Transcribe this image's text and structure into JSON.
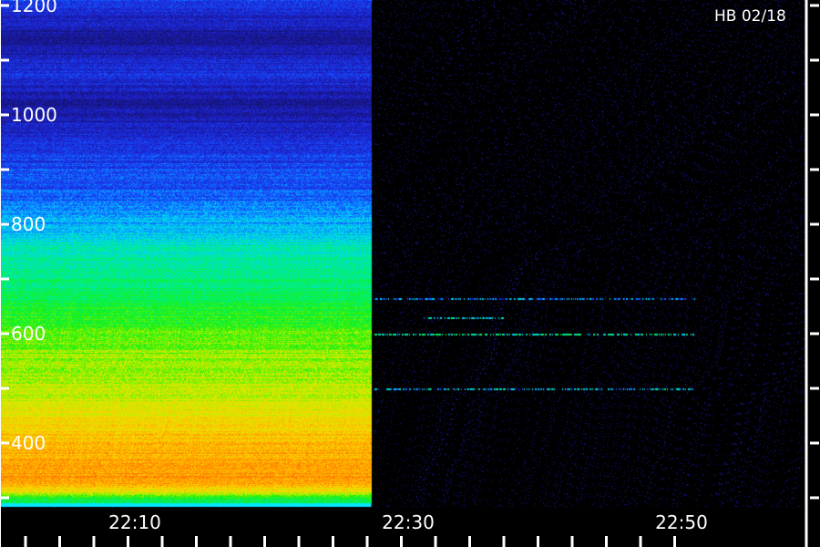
{
  "chart_data": {
    "type": "heatmap",
    "title": "",
    "xlabel": "",
    "ylabel": "",
    "station_label": "HB 02/18",
    "x_unit": "minutes",
    "x_ticks": [
      {
        "value": 10,
        "label": "22:10"
      },
      {
        "value": 30,
        "label": "22:30"
      },
      {
        "value": 50,
        "label": "22:50"
      }
    ],
    "xlim": [
      2,
      51
    ],
    "x_minor_step": 2.5,
    "y_ticks": [
      {
        "value": 400,
        "label": "400"
      },
      {
        "value": 600,
        "label": "600"
      },
      {
        "value": 800,
        "label": "800"
      },
      {
        "value": 1000,
        "label": "1000"
      },
      {
        "value": 1200,
        "label": "1200"
      }
    ],
    "ylim": [
      290,
      1200
    ],
    "y_minor_step": 100,
    "signal_end_time": 27.3,
    "burst_start_time": 28.2,
    "colormap": [
      "#14146e",
      "#1e1ec8",
      "#1450ff",
      "#00d2ff",
      "#00f08c",
      "#14f00a",
      "#c8f000",
      "#ffd200",
      "#ff8200",
      "#ff3c00"
    ],
    "spectrum_profile": [
      {
        "freq": 300,
        "level": 0.52
      },
      {
        "freq": 312,
        "level": 0.72
      },
      {
        "freq": 330,
        "level": 0.86
      },
      {
        "freq": 360,
        "level": 0.84
      },
      {
        "freq": 400,
        "level": 0.8
      },
      {
        "freq": 440,
        "level": 0.76
      },
      {
        "freq": 480,
        "level": 0.68
      },
      {
        "freq": 530,
        "level": 0.66
      },
      {
        "freq": 600,
        "level": 0.6
      },
      {
        "freq": 650,
        "level": 0.52
      },
      {
        "freq": 690,
        "level": 0.46
      },
      {
        "freq": 720,
        "level": 0.44
      },
      {
        "freq": 760,
        "level": 0.4
      },
      {
        "freq": 790,
        "level": 0.32
      },
      {
        "freq": 820,
        "level": 0.3
      },
      {
        "freq": 860,
        "level": 0.22
      },
      {
        "freq": 900,
        "level": 0.2
      },
      {
        "freq": 960,
        "level": 0.13
      },
      {
        "freq": 1020,
        "level": 0.05
      },
      {
        "freq": 1080,
        "level": 0.15
      },
      {
        "freq": 1140,
        "level": 0.04
      },
      {
        "freq": 1200,
        "level": 0.16
      }
    ],
    "spectral_lines": [
      {
        "freq": 600,
        "t_start": 27.5,
        "t_end": 51,
        "level": 0.3
      },
      {
        "freq": 500,
        "t_start": 27.5,
        "t_end": 51,
        "level": 0.2
      },
      {
        "freq": 665,
        "t_start": 27.5,
        "t_end": 51,
        "level": 0.14
      },
      {
        "freq": 630,
        "t_start": 31,
        "t_end": 37,
        "level": 0.22
      }
    ]
  }
}
